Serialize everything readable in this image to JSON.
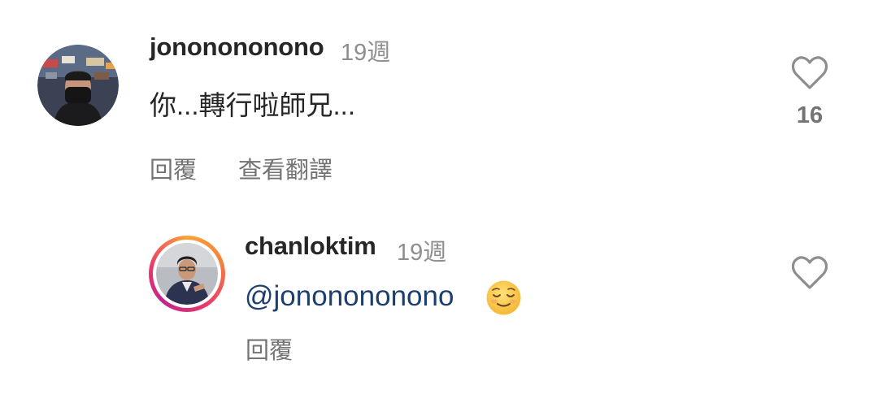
{
  "comments": [
    {
      "username": "jononononono",
      "time": "19週",
      "text": "你...轉行啦師兄...",
      "reply_label": "回覆",
      "translate_label": "查看翻譯",
      "like_count": "16",
      "avatar_icon": "user-avatar-photo"
    },
    {
      "username": "chanloktim",
      "time": "19週",
      "mention": "@jononononono",
      "emoji": "relieved-face-emoji",
      "reply_label": "回覆",
      "avatar_icon": "user-avatar-photo-story-ring"
    }
  ],
  "colors": {
    "text": "#262626",
    "secondary": "#8e8e8e",
    "mention": "#1d3f6e",
    "story_ring": [
      "#f9a23a",
      "#e9386a",
      "#c2238e"
    ]
  }
}
